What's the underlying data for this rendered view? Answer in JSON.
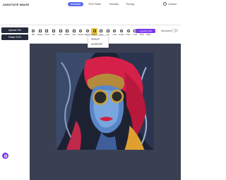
{
  "app": {
    "logo": "ANNOTATE IMAGE"
  },
  "nav": {
    "tabs": [
      {
        "label": "Annotate",
        "active": true
      },
      {
        "label": "SVG Paste",
        "active": false
      },
      {
        "label": "Tutorials",
        "active": false
      },
      {
        "label": "Pricing",
        "active": false
      }
    ]
  },
  "user": {
    "name": "Creator"
  },
  "left": {
    "upload_label": "Upload File",
    "paste_label": "Paste SVG"
  },
  "toolbar": {
    "tools": [
      {
        "label": "Blur",
        "icon": "blur-icon"
      },
      {
        "label": "Shapes",
        "icon": "shapes-icon"
      },
      {
        "label": "Arrow",
        "icon": "arrow-icon"
      },
      {
        "label": "Text",
        "icon": "text-icon"
      },
      {
        "label": "Pen",
        "icon": "pen-icon"
      },
      {
        "label": "Marker",
        "icon": "marker-icon"
      },
      {
        "label": "Crop",
        "icon": "crop-icon"
      },
      {
        "label": "Number",
        "icon": "number-icon"
      },
      {
        "label": "Magnify",
        "icon": "magnify-icon"
      },
      {
        "label": "Select",
        "icon": "cursor-icon",
        "active": true
      },
      {
        "label": "Erase",
        "icon": "eraser-icon"
      },
      {
        "label": "Fill",
        "icon": "fill-icon"
      },
      {
        "label": "Color",
        "icon": "color-icon"
      },
      {
        "label": "Rotate",
        "icon": "rotate-icon"
      },
      {
        "label": "Zoom",
        "icon": "zoom-icon"
      },
      {
        "label": "Undo",
        "icon": "undo-icon"
      },
      {
        "label": "Redo",
        "icon": "redo-icon"
      },
      {
        "label": "Share",
        "icon": "share-icon"
      }
    ],
    "extract_label": "+ Extract Text",
    "advanced_label": "Advanced"
  },
  "dropdown": {
    "items": [
      "GROUP",
      "UNGROUP"
    ]
  },
  "colors": {
    "accent": "#5b6cf0",
    "purple": "#7c3aed",
    "canvas": "#3a4052",
    "active_tool": "#f2c83a"
  }
}
